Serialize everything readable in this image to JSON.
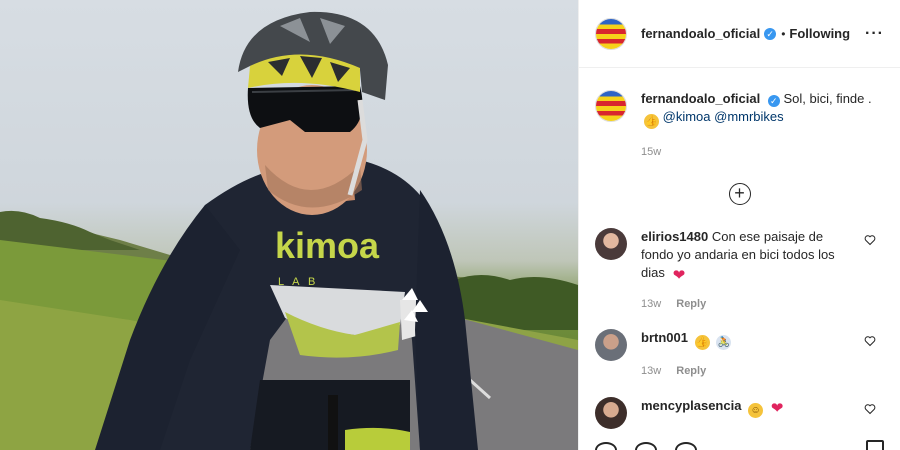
{
  "post": {
    "author": "fernandoalo_oficial",
    "follow_status": "Following",
    "caption_text": "Sol, bici, finde .",
    "mentions": [
      "@kimoa",
      "@mmrbikes"
    ],
    "time": "15w",
    "jersey_text": "kimoa"
  },
  "comments": [
    {
      "user": "elirios1480",
      "text": "Con ese paisaje de fondo yo andaria en bici todos los dias",
      "time": "13w",
      "reply_label": "Reply"
    },
    {
      "user": "brtn001",
      "text": "",
      "time": "13w",
      "reply_label": "Reply"
    },
    {
      "user": "mencyplasencia",
      "text": ""
    }
  ],
  "icons": {
    "more": "more-options-icon",
    "load_more": "plus-circle-icon",
    "like": "heart-outline-icon",
    "verified": "verified-badge-icon"
  },
  "colors": {
    "accent": "#3897f0",
    "mention": "#00376b",
    "muted": "#8e8e8e",
    "text": "#262626"
  }
}
